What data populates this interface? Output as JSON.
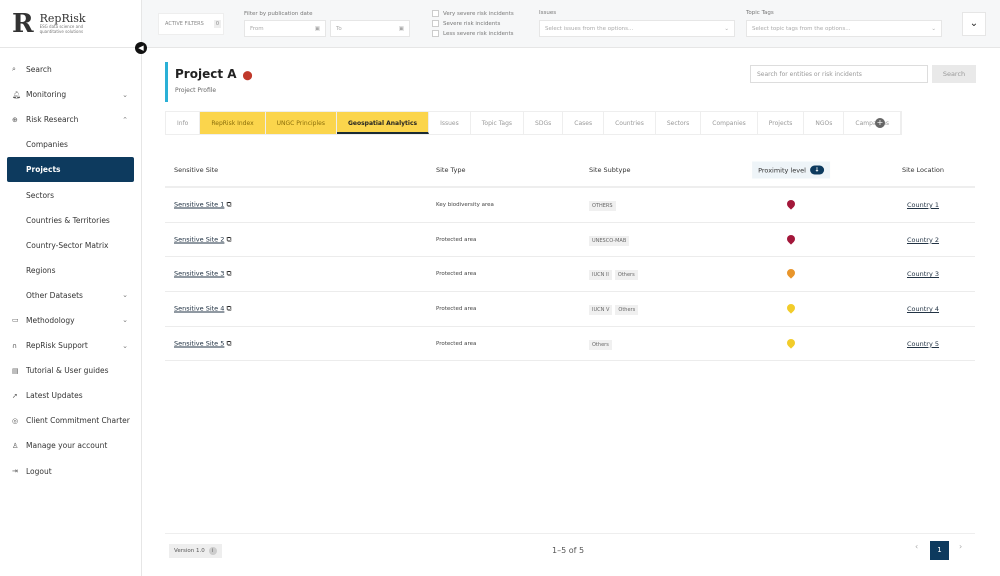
{
  "brand": {
    "name": "RepRisk",
    "tagline": "ESG data science and quantitative solutions"
  },
  "sidebar": {
    "items": [
      {
        "label": "Search",
        "icon": "search-icon",
        "g": "⌕"
      },
      {
        "label": "Monitoring",
        "icon": "bell-icon",
        "g": "🔔︎",
        "chev": "⌄"
      },
      {
        "label": "Risk Research",
        "icon": "globe-icon",
        "g": "⊕",
        "chev": "⌃"
      },
      {
        "label": "Companies",
        "sub": true
      },
      {
        "label": "Projects",
        "sub": true,
        "active": true
      },
      {
        "label": "Sectors",
        "sub": true
      },
      {
        "label": "Countries & Territories",
        "sub": true
      },
      {
        "label": "Country-Sector Matrix",
        "sub": true
      },
      {
        "label": "Regions",
        "sub": true
      },
      {
        "label": "Other Datasets",
        "sub": true,
        "chev": "⌄"
      },
      {
        "label": "Methodology",
        "icon": "book-icon",
        "g": "▭",
        "chev": "⌄"
      },
      {
        "label": "RepRisk Support",
        "icon": "headset-icon",
        "g": "∩",
        "chev": "⌄"
      },
      {
        "label": "Tutorial & User guides",
        "icon": "guide-icon",
        "g": "▤"
      },
      {
        "label": "Latest Updates",
        "icon": "rocket-icon",
        "g": "➚"
      },
      {
        "label": "Client Commitment Charter",
        "icon": "charter-icon",
        "g": "◎"
      },
      {
        "label": "Manage your account",
        "icon": "user-icon",
        "g": "♙"
      },
      {
        "label": "Logout",
        "icon": "logout-icon",
        "g": "⇥"
      }
    ]
  },
  "filters": {
    "active_label": "ACTIVE FILTERS",
    "active_count": "0",
    "date_label": "Filter by publication date",
    "from": "From",
    "to": "To",
    "severity": [
      "Very severe risk incidents",
      "Severe risk incidents",
      "Less severe risk incidents"
    ],
    "issues_label": "Issues",
    "issues_placeholder": "Select issues from the options...",
    "tags_label": "Topic Tags",
    "tags_placeholder": "Select topic tags from the options..."
  },
  "project": {
    "title": "Project A",
    "subtitle": "Project Profile"
  },
  "search": {
    "placeholder": "Search for entities or risk incidents",
    "button": "Search"
  },
  "tabs": [
    {
      "label": "Info"
    },
    {
      "label": "RepRisk Index",
      "y": true
    },
    {
      "label": "UNGC Principles",
      "y": true
    },
    {
      "label": "Geospatial Analytics",
      "cur": true
    },
    {
      "label": "Issues"
    },
    {
      "label": "Topic Tags"
    },
    {
      "label": "SDGs"
    },
    {
      "label": "Cases"
    },
    {
      "label": "Countries"
    },
    {
      "label": "Sectors"
    },
    {
      "label": "Companies"
    },
    {
      "label": "Projects"
    },
    {
      "label": "NGOs"
    },
    {
      "label": "Campaigns"
    }
  ],
  "table": {
    "headers": [
      "Sensitive Site",
      "Site Type",
      "Site Subtype",
      "Proximity level",
      "Site Location"
    ],
    "rows": [
      {
        "site": "Sensitive Site 1",
        "type": "Key biodiversity area",
        "subtypes": [
          "OTHERS"
        ],
        "proximity_color": "#a3173a",
        "location": "Country 1"
      },
      {
        "site": "Sensitive Site 2",
        "type": "Protected area",
        "subtypes": [
          "UNESCO-MAB"
        ],
        "proximity_color": "#a3173a",
        "location": "Country 2"
      },
      {
        "site": "Sensitive Site 3",
        "type": "Protected area",
        "subtypes": [
          "IUCN II",
          "Others"
        ],
        "proximity_color": "#e8952b",
        "location": "Country 3"
      },
      {
        "site": "Sensitive Site 4",
        "type": "Protected area",
        "subtypes": [
          "IUCN V",
          "Others"
        ],
        "proximity_color": "#f2cc2a",
        "location": "Country 4"
      },
      {
        "site": "Sensitive Site 5",
        "type": "Protected area",
        "subtypes": [
          "Others"
        ],
        "proximity_color": "#f2cc2a",
        "location": "Country 5"
      }
    ]
  },
  "footer": {
    "version": "Version 1.0",
    "range": "1–5 of 5",
    "page": "1"
  }
}
